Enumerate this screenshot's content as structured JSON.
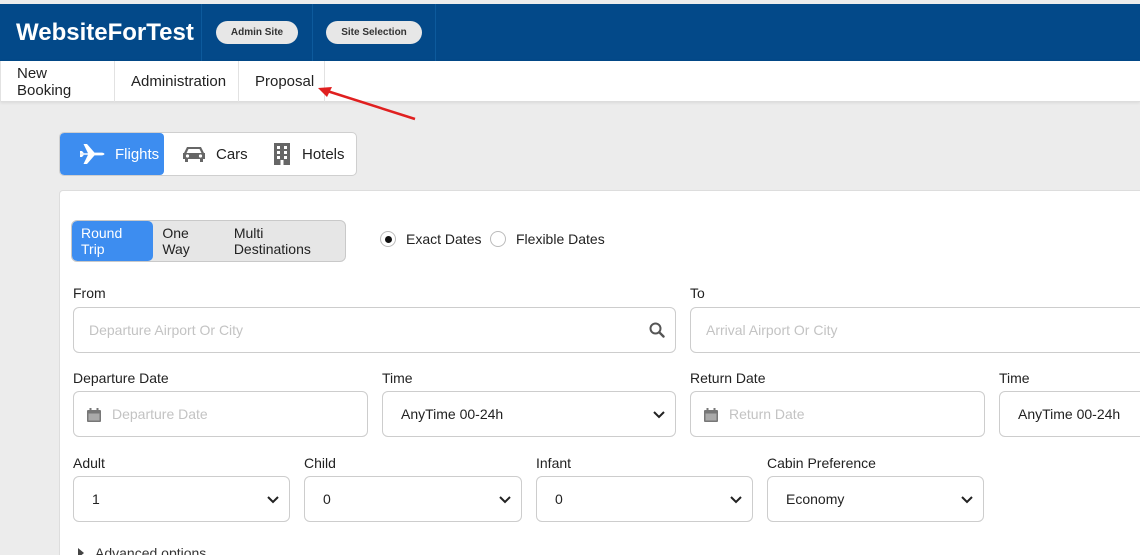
{
  "header": {
    "brand": "WebsiteForTest",
    "admin_site": "Admin Site",
    "site_selection": "Site Selection"
  },
  "nav": {
    "items": [
      "New Booking",
      "Administration",
      "Proposal"
    ]
  },
  "product_tabs": {
    "flights": "Flights",
    "cars": "Cars",
    "hotels": "Hotels"
  },
  "trip_types": {
    "round_trip": "Round Trip",
    "one_way": "One Way",
    "multi": "Multi Destinations"
  },
  "date_mode": {
    "exact": "Exact Dates",
    "flexible": "Flexible Dates"
  },
  "form": {
    "from_label": "From",
    "from_placeholder": "Departure Airport Or City",
    "to_label": "To",
    "to_placeholder": "Arrival Airport Or City",
    "departure_date_label": "Departure Date",
    "departure_date_placeholder": "Departure Date",
    "time_label": "Time",
    "time_value": "AnyTime 00-24h",
    "return_date_label": "Return Date",
    "return_date_placeholder": "Return Date",
    "return_time_label": "Time",
    "return_time_value": "AnyTime 00-24h",
    "adult_label": "Adult",
    "adult_value": "1",
    "child_label": "Child",
    "child_value": "0",
    "infant_label": "Infant",
    "infant_value": "0",
    "cabin_label": "Cabin Preference",
    "cabin_value": "Economy",
    "advanced": "Advanced options"
  },
  "colors": {
    "header_bg": "#034989",
    "accent": "#3d8df0",
    "annotation_arrow": "#e02020"
  }
}
